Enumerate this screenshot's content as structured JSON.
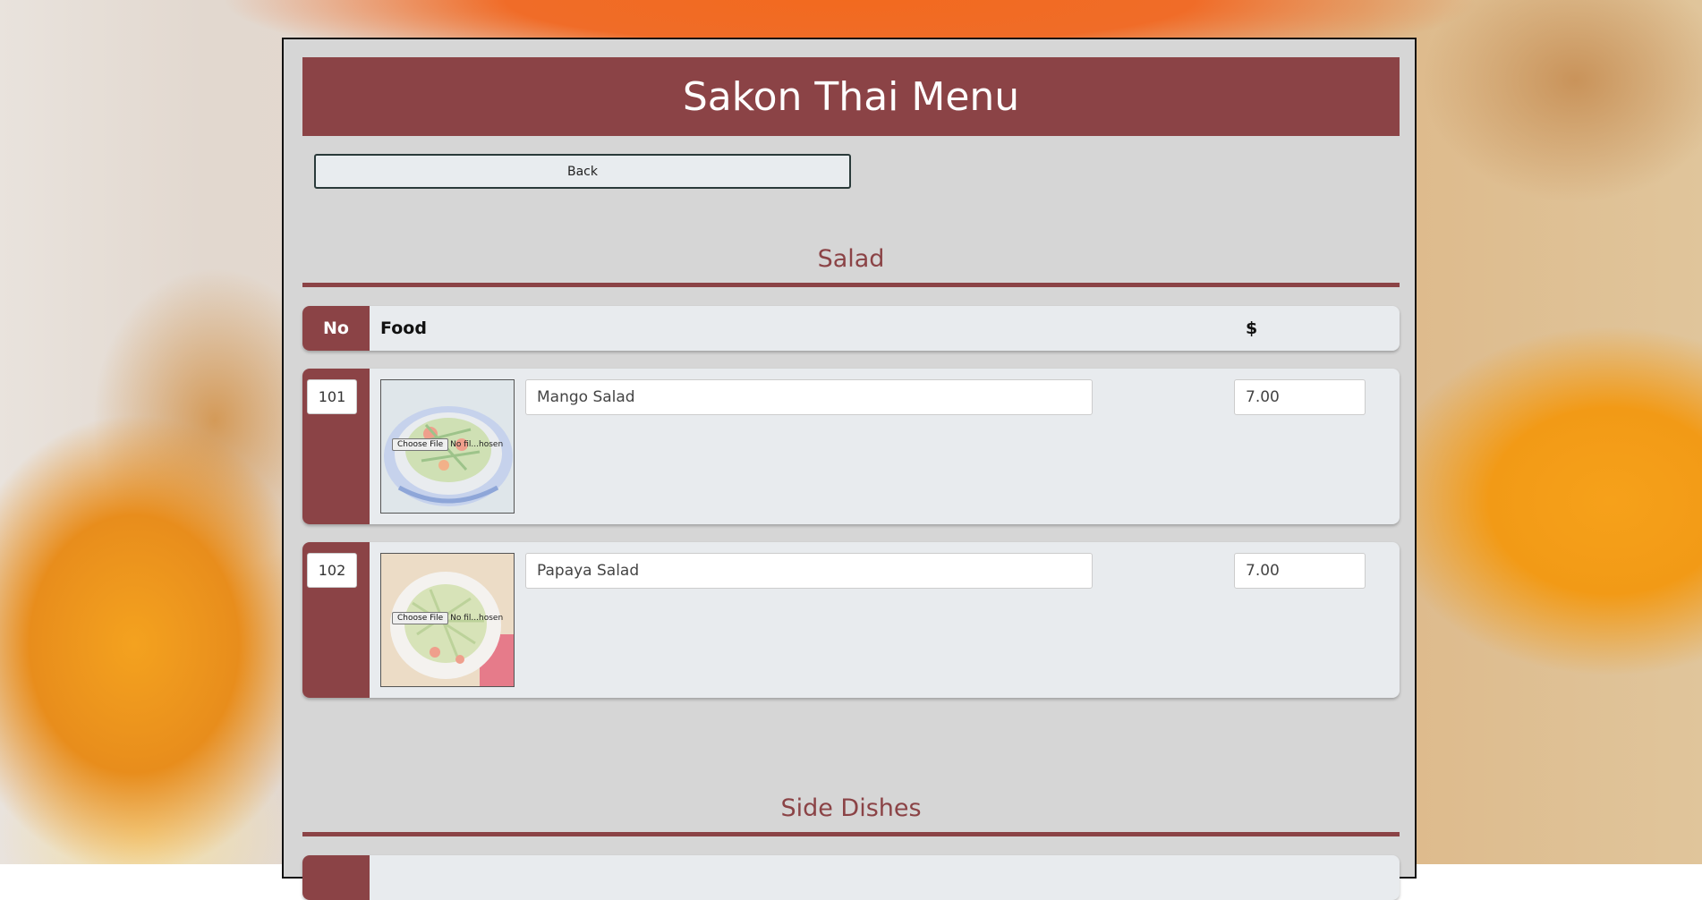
{
  "page": {
    "title": "Sakon Thai Menu",
    "back_label": "Back"
  },
  "colors": {
    "brand": "#8b4346",
    "panel": "#d6d6d6",
    "row": "#e8ebee"
  },
  "table_headers": {
    "no": "No",
    "food": "Food",
    "price": "$"
  },
  "sections": [
    {
      "title": "Salad",
      "items": [
        {
          "no": "101",
          "name": "Mango Salad",
          "price": "7.00",
          "file_button": "Choose File",
          "file_status": "No fil...hosen"
        },
        {
          "no": "102",
          "name": "Papaya Salad",
          "price": "7.00",
          "file_button": "Choose File",
          "file_status": "No fil...hosen"
        }
      ]
    },
    {
      "title": "Side Dishes",
      "items": []
    }
  ]
}
